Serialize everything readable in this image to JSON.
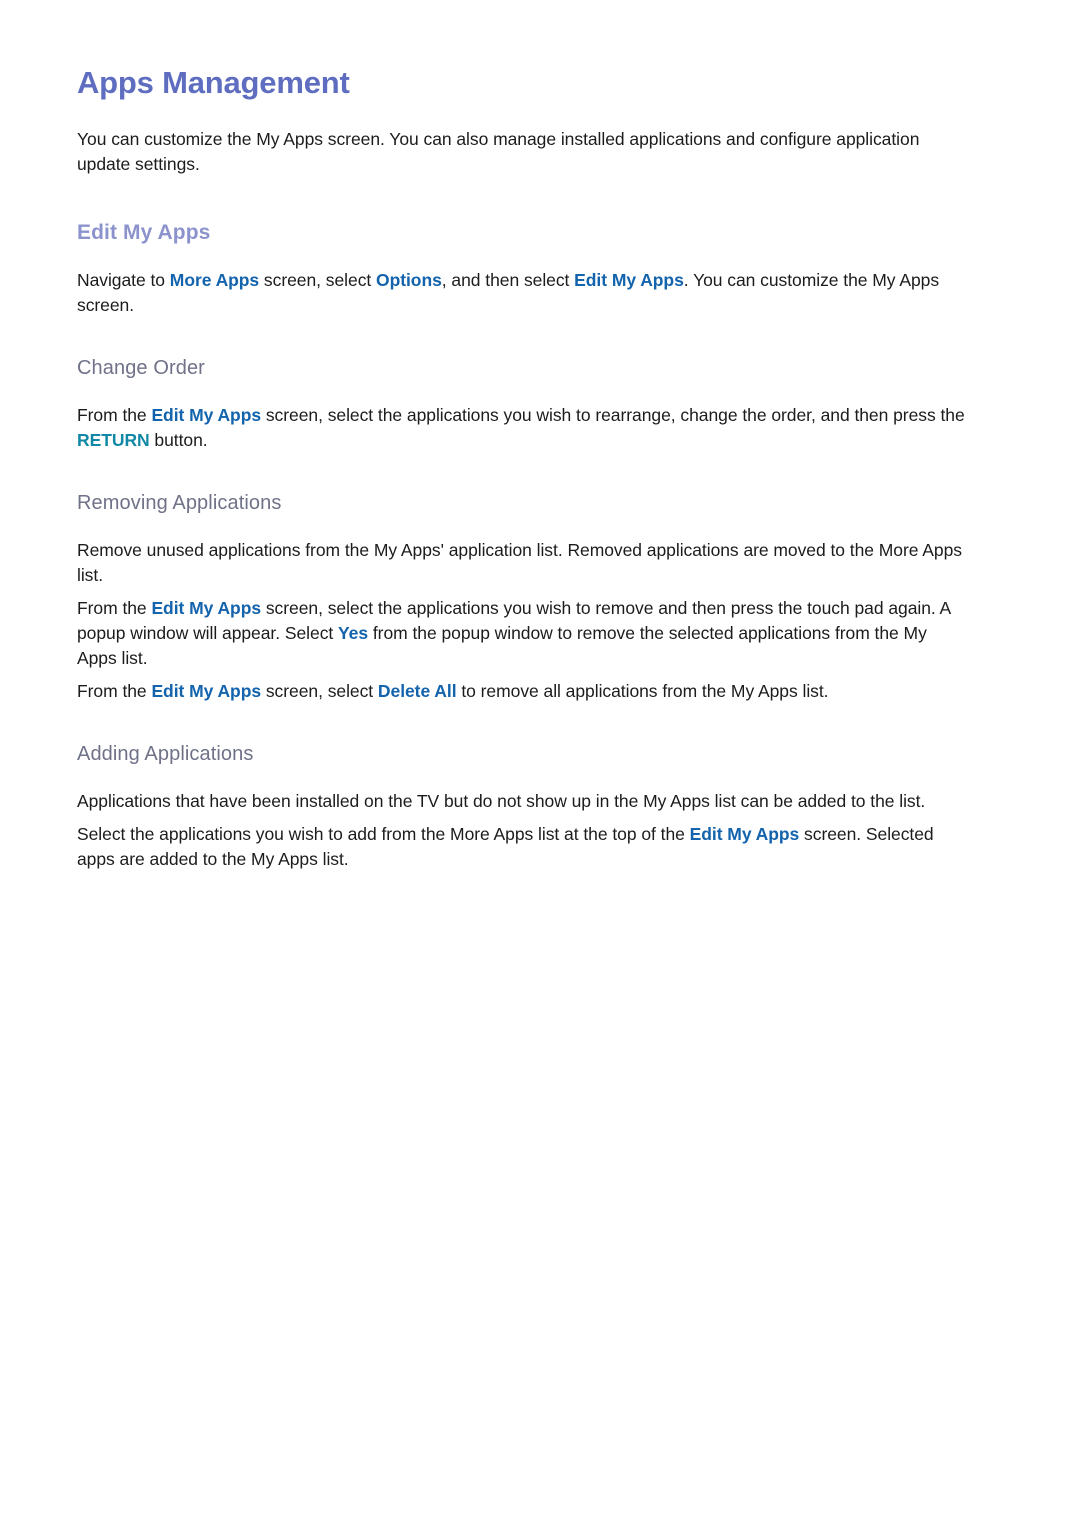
{
  "colors": {
    "page_background": "#ffffff",
    "title": "#5f6dc0",
    "heading_2": "#8c93cc",
    "heading_3": "#6f7288",
    "body_text": "#1c1c1c",
    "inline_link": "#1363ad",
    "key_button": "#1189a6"
  },
  "document": {
    "title": "Apps Management",
    "intro": {
      "before": "You can customize the My Apps screen. You can also manage installed applications and configure application update settings."
    },
    "sections": [
      {
        "heading": "Edit My Apps",
        "level": 2,
        "paragraphs": [
          {
            "runs": [
              {
                "text": "Navigate to ",
                "style": "normal"
              },
              {
                "text": "More Apps",
                "style": "link"
              },
              {
                "text": " screen, select ",
                "style": "normal"
              },
              {
                "text": "Options",
                "style": "link"
              },
              {
                "text": ", and then select ",
                "style": "normal"
              },
              {
                "text": "Edit My Apps",
                "style": "link"
              },
              {
                "text": ". You can customize the My Apps screen.",
                "style": "normal"
              }
            ]
          }
        ]
      },
      {
        "heading": "Change Order",
        "level": 3,
        "paragraphs": [
          {
            "runs": [
              {
                "text": "From the ",
                "style": "normal"
              },
              {
                "text": "Edit My Apps",
                "style": "link"
              },
              {
                "text": " screen, select the applications you wish to rearrange, change the order, and then press the ",
                "style": "normal"
              },
              {
                "text": "RETURN",
                "style": "key"
              },
              {
                "text": " button.",
                "style": "normal"
              }
            ]
          }
        ]
      },
      {
        "heading": "Removing Applications",
        "level": 3,
        "paragraphs": [
          {
            "runs": [
              {
                "text": "Remove unused applications from the My Apps' application list. Removed applications are moved to the More Apps list.",
                "style": "normal"
              }
            ]
          },
          {
            "runs": [
              {
                "text": "From the ",
                "style": "normal"
              },
              {
                "text": "Edit My Apps",
                "style": "link"
              },
              {
                "text": " screen, select the applications you wish to remove and then press the touch pad again. A popup window will appear. Select ",
                "style": "normal"
              },
              {
                "text": "Yes",
                "style": "link"
              },
              {
                "text": " from the popup window to remove the selected applications from the My Apps list.",
                "style": "normal"
              }
            ]
          },
          {
            "runs": [
              {
                "text": "From the ",
                "style": "normal"
              },
              {
                "text": "Edit My Apps",
                "style": "link"
              },
              {
                "text": " screen, select ",
                "style": "normal"
              },
              {
                "text": "Delete All",
                "style": "link"
              },
              {
                "text": " to remove all applications from the My Apps list.",
                "style": "normal"
              }
            ]
          }
        ]
      },
      {
        "heading": "Adding Applications",
        "level": 3,
        "paragraphs": [
          {
            "runs": [
              {
                "text": "Applications that have been installed on the TV but do not show up in the My Apps list can be added to the list.",
                "style": "normal"
              }
            ]
          },
          {
            "runs": [
              {
                "text": "Select the applications you wish to add from the More Apps list at the top of the ",
                "style": "normal"
              },
              {
                "text": "Edit My Apps",
                "style": "link"
              },
              {
                "text": " screen. Selected apps are added to the My Apps list.",
                "style": "normal"
              }
            ]
          }
        ]
      }
    ]
  }
}
